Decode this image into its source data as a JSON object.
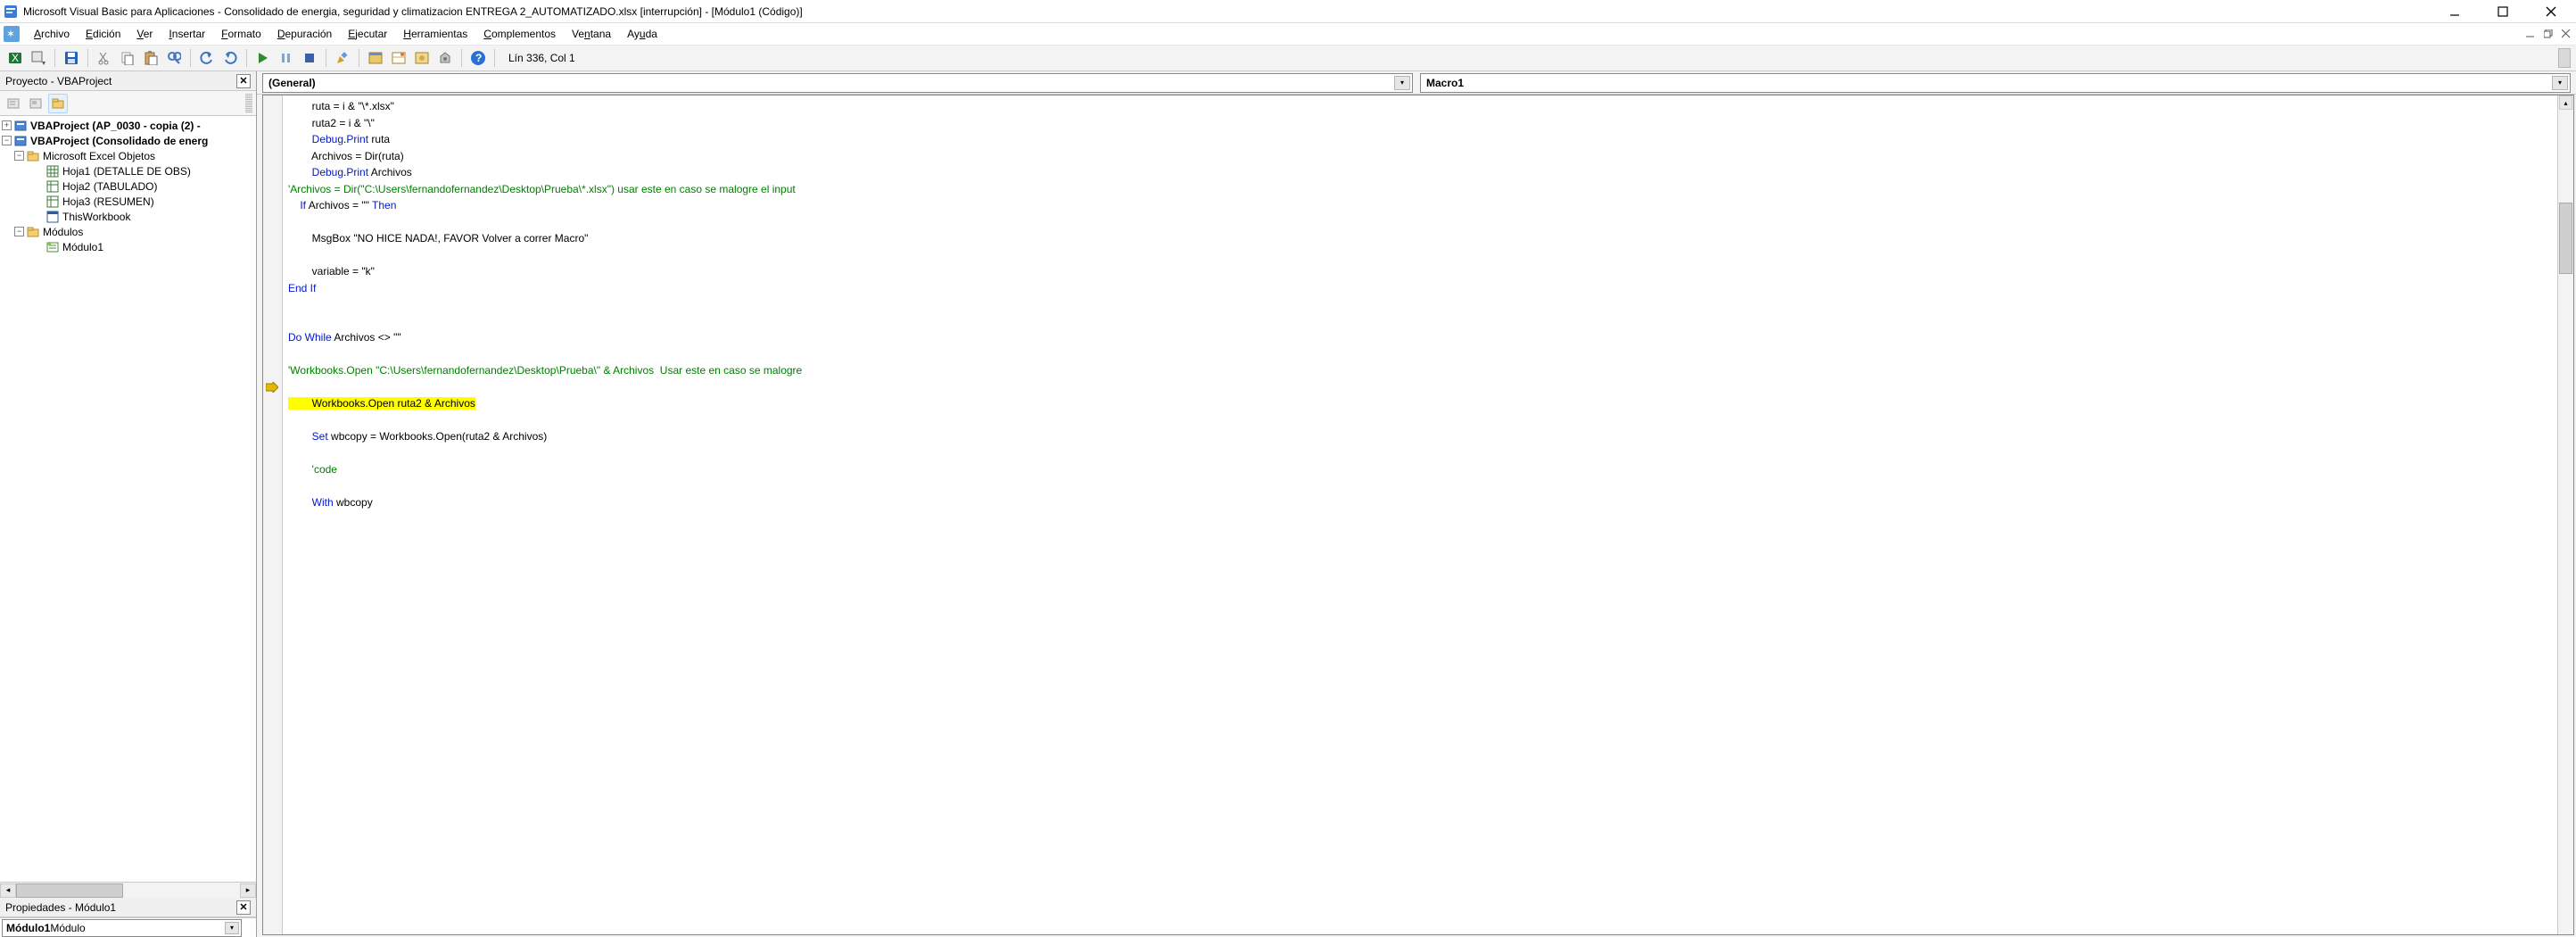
{
  "title": "Microsoft Visual Basic para Aplicaciones - Consolidado de energia, seguridad y climatizacion ENTREGA 2_AUTOMATIZADO.xlsx [interrupción] - [Módulo1 (Código)]",
  "menu": {
    "archivo": "Archivo",
    "edicion": "Edición",
    "ver": "Ver",
    "insertar": "Insertar",
    "formato": "Formato",
    "depuracion": "Depuración",
    "ejecutar": "Ejecutar",
    "herramientas": "Herramientas",
    "complementos": "Complementos",
    "ventana": "Ventana",
    "ayuda": "Ayuda"
  },
  "toolbar_status": "Lín 336, Col 1",
  "project_panel_title": "Proyecto - VBAProject",
  "tree": {
    "p1": "VBAProject (AP_0030 - copia (2) -",
    "p2": "VBAProject (Consolidado de energ",
    "grp_excel": "Microsoft Excel Objetos",
    "h1": "Hoja1 (DETALLE DE OBS)",
    "h2": "Hoja2 (TABULADO)",
    "h3": "Hoja3 (RESUMEN)",
    "tw": "ThisWorkbook",
    "grp_mod": "Módulos",
    "mod1": "Módulo1"
  },
  "props_title": "Propiedades - Módulo1",
  "props_combo_bold": "Módulo1",
  "props_combo_rest": " Módulo",
  "combo_general": "(General)",
  "combo_proc": "Macro1",
  "code": {
    "l1a": "        ruta = i & ",
    "l1b": "\"\\*.xlsx\"",
    "l2a": "        ruta2 = i & ",
    "l2b": "\"\\\"",
    "l3a": "        Debug",
    "l3b": ".",
    "l3c": "Print",
    "l3d": " ruta",
    "l4": "        Archivos = Dir(ruta)",
    "l5a": "        Debug",
    "l5b": ".",
    "l5c": "Print",
    "l5d": " Archivos",
    "l6": "'Archivos = Dir(\"C:\\Users\\fernandofernandez\\Desktop\\Prueba\\*.xlsx\") usar este en caso se malogre el input",
    "l7a": "    If",
    "l7b": " Archivos = ",
    "l7c": "\"\"",
    "l7d": " Then",
    "l8": "",
    "l9a": "        MsgBox ",
    "l9b": "\"NO HICE NADA!, FAVOR Volver a correr Macro\"",
    "l10": "",
    "l11a": "        variable = ",
    "l11b": "\"k\"",
    "l12": "End If",
    "l13": "",
    "l14": "",
    "l15a": "Do While",
    "l15b": " Archivos <> ",
    "l15c": "\"\"",
    "l16": "",
    "l17": "'Workbooks.Open \"C:\\Users\\fernandofernandez\\Desktop\\Prueba\\\" & Archivos  Usar este en caso se malogre",
    "l18": "",
    "l19": "        Workbooks.Open ruta2 & Archivos",
    "l20": "",
    "l21a": "        Set",
    "l21b": " wbcopy = Workbooks.Open(ruta2 & Archivos)",
    "l22": "",
    "l23": "        'code",
    "l24": "",
    "l25a": "        With",
    "l25b": " wbcopy"
  }
}
